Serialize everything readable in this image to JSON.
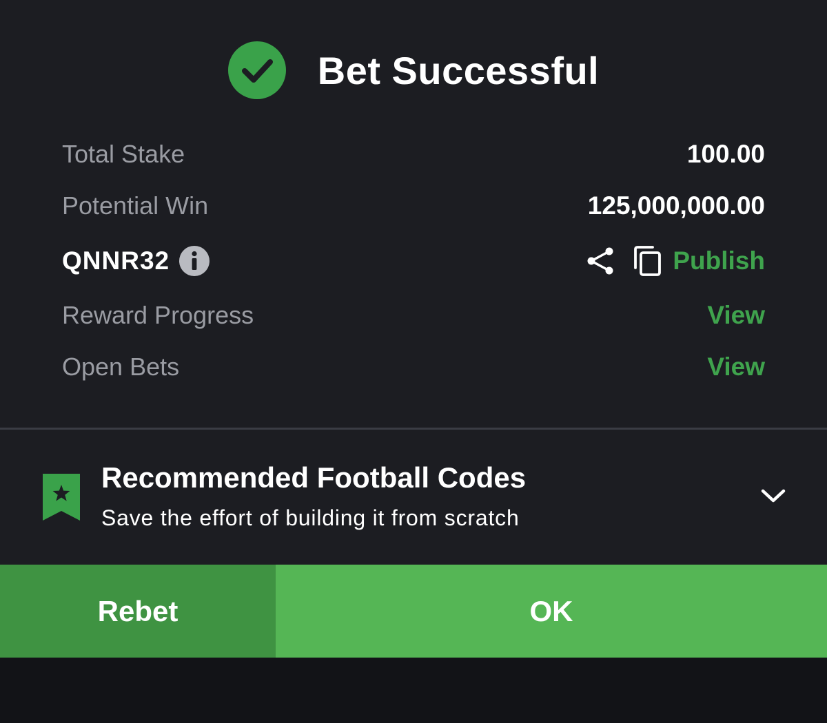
{
  "header": {
    "title": "Bet Successful"
  },
  "summary": {
    "total_stake_label": "Total Stake",
    "total_stake_value": "100.00",
    "potential_win_label": "Potential Win",
    "potential_win_value": "125,000,000.00",
    "booking_code": "QNNR32",
    "publish_label": "Publish",
    "reward_progress_label": "Reward Progress",
    "reward_progress_link": "View",
    "open_bets_label": "Open Bets",
    "open_bets_link": "View"
  },
  "recommended": {
    "title": "Recommended Football Codes",
    "subtitle": "Save the effort of building it from scratch"
  },
  "actions": {
    "rebet_label": "Rebet",
    "ok_label": "OK"
  },
  "icons": {
    "success": "check-circle-icon",
    "info": "info-icon",
    "share": "share-icon",
    "copy": "copy-icon",
    "bookmark": "bookmark-star-icon",
    "expand": "chevron-down-icon"
  },
  "colors": {
    "background": "#1c1d22",
    "accent_green": "#3fa34d",
    "success_circle": "#3aa24a",
    "rebet_button": "#3f9342",
    "ok_button": "#55b655",
    "muted_text": "#9a9ca3"
  }
}
